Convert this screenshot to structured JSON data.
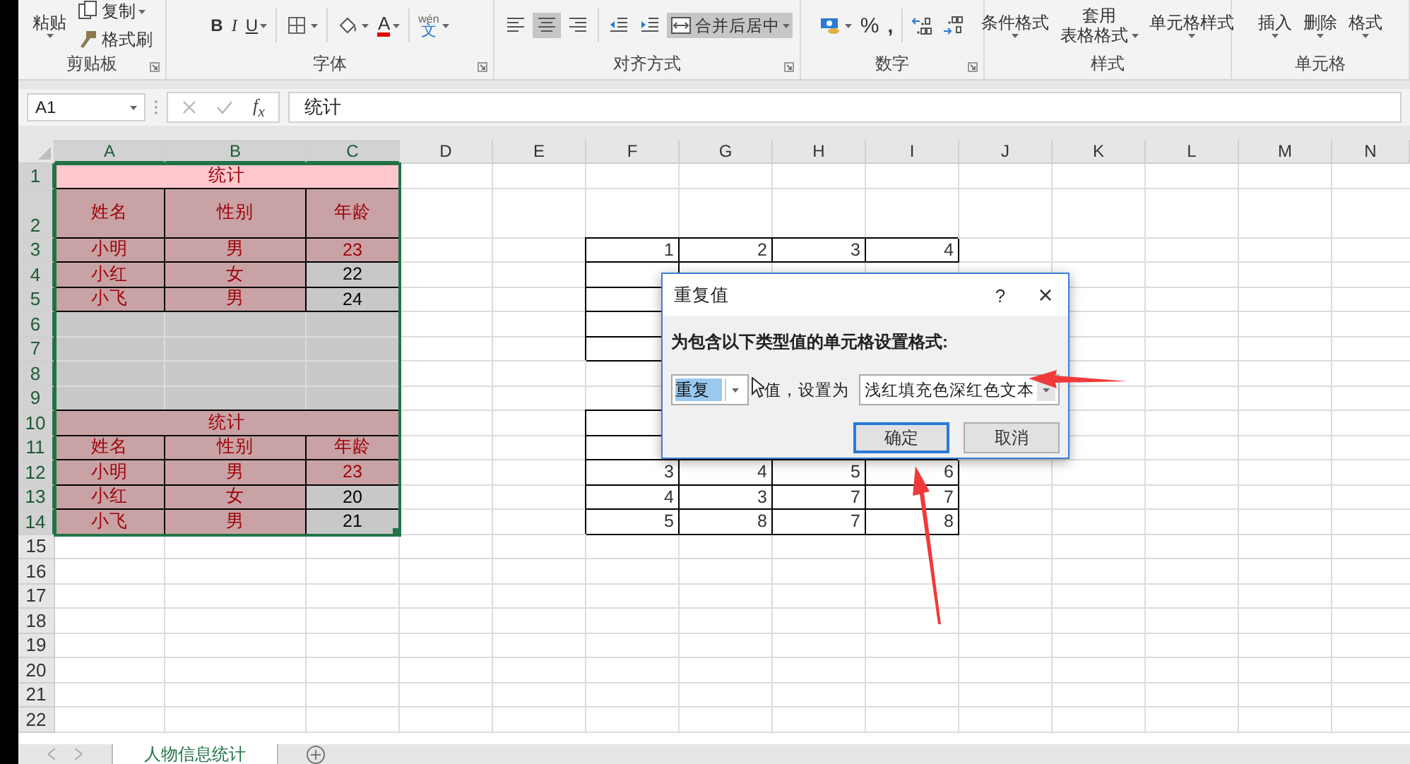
{
  "ribbon": {
    "groups": [
      {
        "label": "剪贴板",
        "launcher": true,
        "items": [
          {
            "kind": "paste",
            "label": "粘贴",
            "dropdown": true
          },
          {
            "kind": "stack",
            "items": [
              {
                "kind": "copy",
                "label": "复制",
                "dropdown": true
              },
              {
                "kind": "format-painter",
                "label": "格式刷",
                "dropdown": false
              }
            ]
          }
        ]
      },
      {
        "label": "字体",
        "launcher": true,
        "items": [
          {
            "kind": "bold",
            "label": "B",
            "selected": false,
            "dropdown": false
          },
          {
            "kind": "italic",
            "label": "I",
            "selected": false,
            "dropdown": false
          },
          {
            "kind": "underline",
            "label": "U",
            "selected": false,
            "dropdown": true
          },
          {
            "kind": "divider"
          },
          {
            "kind": "borders",
            "dropdown": true
          },
          {
            "kind": "divider"
          },
          {
            "kind": "fill-color",
            "dropdown": true
          },
          {
            "kind": "font-color",
            "label": "A",
            "dropdown": true
          },
          {
            "kind": "divider"
          },
          {
            "kind": "phonetic",
            "label": "文",
            "ruby": "wén",
            "dropdown": true
          }
        ]
      },
      {
        "label": "对齐方式",
        "launcher": true,
        "items": [
          {
            "kind": "align-left",
            "selected": false,
            "dropdown": false
          },
          {
            "kind": "align-center",
            "selected": true,
            "dropdown": false
          },
          {
            "kind": "align-right",
            "selected": false,
            "dropdown": false
          },
          {
            "kind": "divider"
          },
          {
            "kind": "indent-less",
            "dropdown": false
          },
          {
            "kind": "indent-more",
            "dropdown": false
          },
          {
            "kind": "merge",
            "label": "合并后居中",
            "selected": true,
            "dropdown": true
          }
        ]
      },
      {
        "label": "数字",
        "launcher": true,
        "items": [
          {
            "kind": "currency",
            "dropdown": true
          },
          {
            "kind": "percent",
            "label": "%",
            "dropdown": false
          },
          {
            "kind": "comma",
            "label": ",",
            "dropdown": false
          },
          {
            "kind": "divider"
          },
          {
            "kind": "dec-more",
            "dropdown": false
          },
          {
            "kind": "dec-less",
            "dropdown": false
          }
        ]
      },
      {
        "label": "样式",
        "launcher": false,
        "items": [
          {
            "kind": "large",
            "lines": [
              "条件格式"
            ],
            "dropdown": true
          },
          {
            "kind": "large",
            "lines": [
              "套用",
              "表格格式"
            ],
            "dropdown": true
          },
          {
            "kind": "large",
            "lines": [
              "单元格样式"
            ],
            "dropdown": true
          }
        ]
      },
      {
        "label": "单元格",
        "launcher": false,
        "items": [
          {
            "kind": "large",
            "lines": [
              "插入"
            ],
            "dropdown": true
          },
          {
            "kind": "large",
            "lines": [
              "删除"
            ],
            "dropdown": true
          },
          {
            "kind": "large",
            "lines": [
              "格式"
            ],
            "dropdown": true
          }
        ]
      }
    ]
  },
  "formula_bar": {
    "name_box": "A1",
    "function_label": "f$_{x}$",
    "value": "统计"
  },
  "sheet": {
    "columns": [
      {
        "label": "A",
        "selected": true
      },
      {
        "label": "B",
        "selected": true
      },
      {
        "label": "C",
        "selected": true
      },
      {
        "label": "D",
        "selected": false
      },
      {
        "label": "E",
        "selected": false
      },
      {
        "label": "F",
        "selected": false
      },
      {
        "label": "G",
        "selected": false
      },
      {
        "label": "H",
        "selected": false
      },
      {
        "label": "I",
        "selected": false
      },
      {
        "label": "J",
        "selected": false
      },
      {
        "label": "K",
        "selected": false
      },
      {
        "label": "L",
        "selected": false
      },
      {
        "label": "M",
        "selected": false
      },
      {
        "label": "N",
        "selected": false
      }
    ],
    "rows": [
      {
        "label": "1",
        "selected": true
      },
      {
        "label": "2",
        "selected": true
      },
      {
        "label": "3",
        "selected": true
      },
      {
        "label": "4",
        "selected": true
      },
      {
        "label": "5",
        "selected": true
      },
      {
        "label": "6",
        "selected": true
      },
      {
        "label": "7",
        "selected": true
      },
      {
        "label": "8",
        "selected": true
      },
      {
        "label": "9",
        "selected": true
      },
      {
        "label": "10",
        "selected": true
      },
      {
        "label": "11",
        "selected": true
      },
      {
        "label": "12",
        "selected": true
      },
      {
        "label": "13",
        "selected": true
      },
      {
        "label": "14",
        "selected": true
      },
      {
        "label": "15",
        "selected": false
      },
      {
        "label": "16",
        "selected": false
      },
      {
        "label": "17",
        "selected": false
      },
      {
        "label": "18",
        "selected": false
      },
      {
        "label": "19",
        "selected": false
      },
      {
        "label": "20",
        "selected": false
      },
      {
        "label": "21",
        "selected": false
      },
      {
        "label": "22",
        "selected": false
      }
    ],
    "left_table": {
      "selected": true,
      "rows": [
        {
          "cells": [
            {
              "text": "统计",
              "duplicate": true,
              "active": true
            }
          ]
        },
        {
          "cells": [
            {
              "text": "姓名",
              "duplicate": true,
              "active": false
            },
            {
              "text": "性别",
              "duplicate": true,
              "active": false
            },
            {
              "text": "年龄",
              "duplicate": true,
              "active": false
            }
          ]
        },
        {
          "cells": [
            {
              "text": "小明",
              "duplicate": true,
              "active": false
            },
            {
              "text": "男",
              "duplicate": true,
              "active": false
            },
            {
              "text": "23",
              "duplicate": true,
              "active": false
            }
          ]
        },
        {
          "cells": [
            {
              "text": "小红",
              "duplicate": true,
              "active": false
            },
            {
              "text": "女",
              "duplicate": true,
              "active": false
            },
            {
              "text": "22",
              "duplicate": false,
              "active": false
            }
          ]
        },
        {
          "cells": [
            {
              "text": "小飞",
              "duplicate": true,
              "active": false
            },
            {
              "text": "男",
              "duplicate": true,
              "active": false
            },
            {
              "text": "24",
              "duplicate": false,
              "active": false
            }
          ]
        },
        {
          "cells": [
            {
              "duplicate": false,
              "active": false
            },
            {
              "duplicate": false,
              "active": false
            },
            {
              "duplicate": false,
              "active": false
            }
          ]
        },
        {
          "cells": [
            {
              "duplicate": false,
              "active": false
            },
            {
              "duplicate": false,
              "active": false
            },
            {
              "duplicate": false,
              "active": false
            }
          ]
        },
        {
          "cells": [
            {
              "duplicate": false,
              "active": false
            },
            {
              "duplicate": false,
              "active": false
            },
            {
              "duplicate": false,
              "active": false
            }
          ]
        },
        {
          "cells": [
            {
              "duplicate": false,
              "active": false
            },
            {
              "duplicate": false,
              "active": false
            },
            {
              "duplicate": false,
              "active": false
            }
          ]
        },
        {
          "cells": [
            {
              "text": "统计",
              "duplicate": true,
              "active": false
            }
          ]
        },
        {
          "cells": [
            {
              "text": "姓名",
              "duplicate": true,
              "active": false
            },
            {
              "text": "性别",
              "duplicate": true,
              "active": false
            },
            {
              "text": "年龄",
              "duplicate": true,
              "active": false
            }
          ]
        },
        {
          "cells": [
            {
              "text": "小明",
              "duplicate": true,
              "active": false
            },
            {
              "text": "男",
              "duplicate": true,
              "active": false
            },
            {
              "text": "23",
              "duplicate": true,
              "active": false
            }
          ]
        },
        {
          "cells": [
            {
              "text": "小红",
              "duplicate": true,
              "active": false
            },
            {
              "text": "女",
              "duplicate": true,
              "active": false
            },
            {
              "text": "20",
              "duplicate": false,
              "active": false
            }
          ]
        },
        {
          "cells": [
            {
              "text": "小飞",
              "duplicate": true,
              "active": false
            },
            {
              "text": "男",
              "duplicate": true,
              "active": false
            },
            {
              "text": "21",
              "duplicate": false,
              "active": false
            }
          ]
        }
      ]
    },
    "right_table": {
      "blocks": [
        {
          "rows": [
            {
              "cells": [
                "1",
                "2",
                "3",
                "4"
              ]
            }
          ]
        },
        {
          "rows": [
            {
              "cells": [
                "3",
                "4",
                "5",
                "6"
              ]
            },
            {
              "cells": [
                "4",
                "3",
                "7",
                "7"
              ]
            },
            {
              "cells": [
                "5",
                "8",
                "7",
                "8"
              ]
            }
          ]
        }
      ]
    }
  },
  "dialog": {
    "title": "重复值",
    "help": "?",
    "close": "×",
    "instruction": "为包含以下类型值的单元格设置格式:",
    "rule": "重复",
    "rule_suffix": "值，设置为",
    "format": "浅红填充色深红色文本",
    "buttons": [
      {
        "label": "确定",
        "default": true
      },
      {
        "label": "取消",
        "default": false
      }
    ]
  },
  "sheet_tabs": [
    {
      "label": "人物信息统计",
      "selected": true
    }
  ]
}
